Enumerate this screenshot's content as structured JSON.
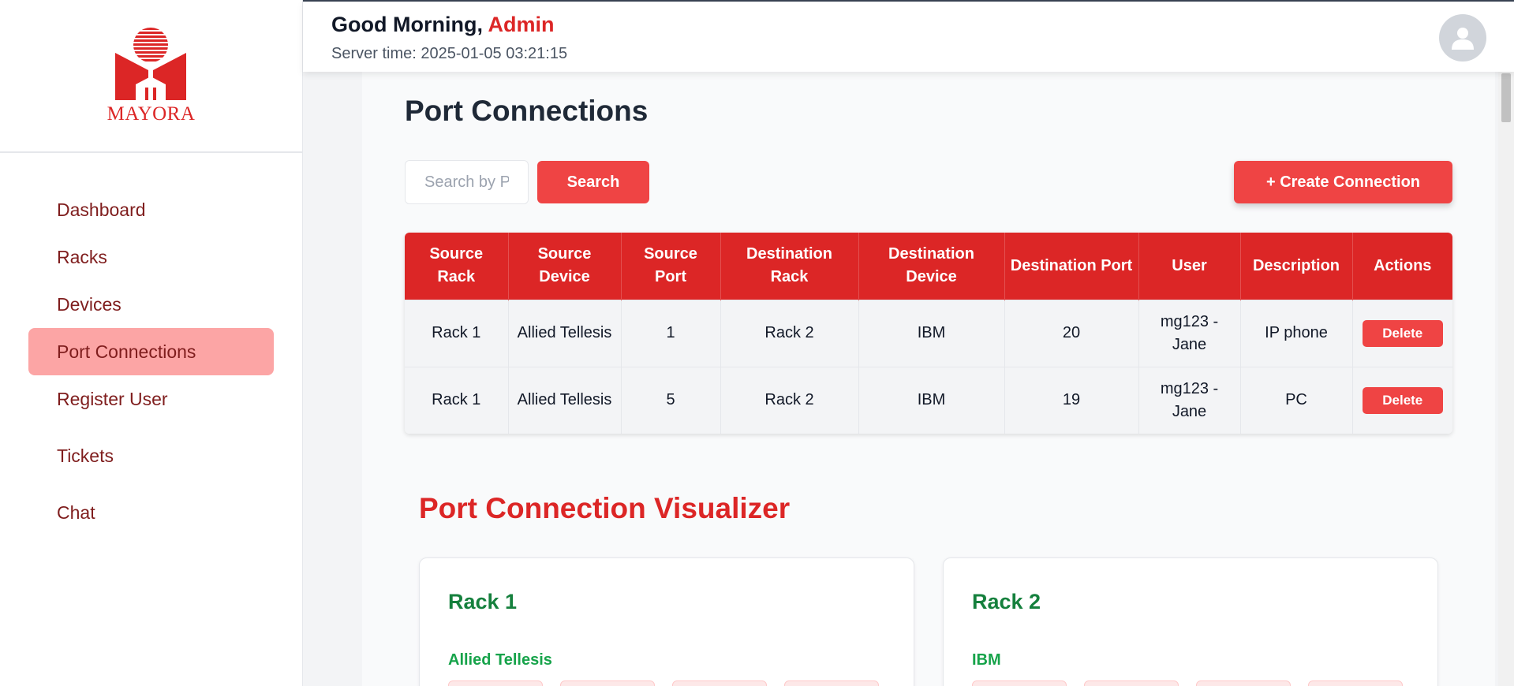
{
  "brand": {
    "logo_text": "MAYORA"
  },
  "header": {
    "greeting": "Good Morning,",
    "user_name": "Admin",
    "server_time": "Server time: 2025-01-05 03:21:15"
  },
  "sidebar": {
    "items": [
      {
        "label": "Dashboard"
      },
      {
        "label": "Racks"
      },
      {
        "label": "Devices"
      },
      {
        "label": "Port Connections"
      },
      {
        "label": "Register User"
      },
      {
        "label": "Tickets"
      },
      {
        "label": "Chat"
      }
    ]
  },
  "main": {
    "title": "Port Connections",
    "search": {
      "placeholder": "Search by Port",
      "button": "Search"
    },
    "create_button": "+ Create Connection",
    "table": {
      "headers": [
        "Source Rack",
        "Source Device",
        "Source Port",
        "Destination Rack",
        "Destination Device",
        "Destination Port",
        "User",
        "Description",
        "Actions"
      ],
      "rows": [
        {
          "source_rack": "Rack 1",
          "source_device": "Allied Tellesis",
          "source_port": "1",
          "dest_rack": "Rack 2",
          "dest_device": "IBM",
          "dest_port": "20",
          "user": "mg123 - Jane",
          "description": "IP phone",
          "action": "Delete"
        },
        {
          "source_rack": "Rack 1",
          "source_device": "Allied Tellesis",
          "source_port": "5",
          "dest_rack": "Rack 2",
          "dest_device": "IBM",
          "dest_port": "19",
          "user": "mg123 - Jane",
          "description": "PC",
          "action": "Delete"
        }
      ]
    },
    "visualizer": {
      "title": "Port Connection Visualizer",
      "racks": [
        {
          "name": "Rack 1",
          "device": "Allied Tellesis"
        },
        {
          "name": "Rack 2",
          "device": "IBM"
        }
      ]
    }
  },
  "colors": {
    "accent": "#dc2626",
    "button": "#ef4444",
    "nav_active": "#fca5a5",
    "nav_text": "#7f1d1d",
    "rack_title": "#15803d"
  }
}
